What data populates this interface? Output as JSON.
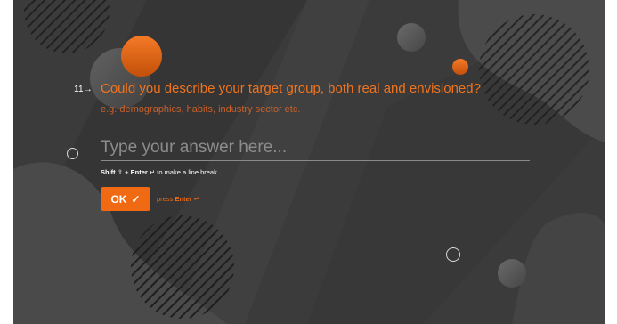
{
  "question": {
    "number": "11",
    "arrow_icon": "arrow-right-icon",
    "title": "Could you describe your target group, both real and envisioned?",
    "description": "e.g. demographics, habits, industry sector etc."
  },
  "answer": {
    "placeholder": "Type your answer here...",
    "value": ""
  },
  "hint": {
    "shift_label": "Shift",
    "plus": "+",
    "enter_label": "Enter",
    "suffix": "to make a line break"
  },
  "ok_button": {
    "label": "OK",
    "icon": "checkmark-icon"
  },
  "press_hint": {
    "prefix": "press",
    "key": "Enter"
  },
  "colors": {
    "accent": "#f06a14",
    "background": "#3b3b3b",
    "question_text": "#f0741e"
  }
}
